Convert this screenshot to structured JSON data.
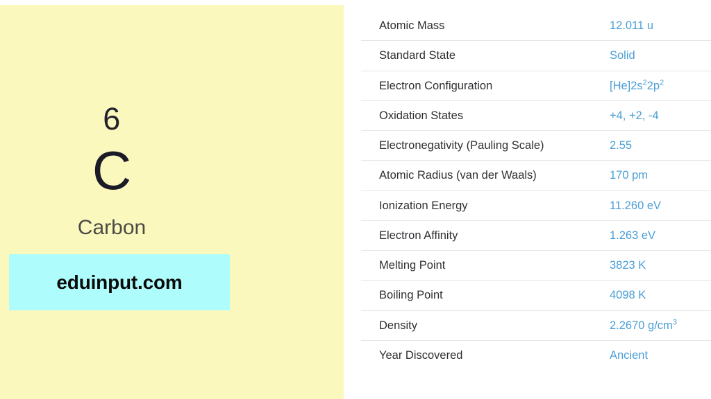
{
  "element": {
    "atomic_number": "6",
    "symbol": "C",
    "name": "Carbon",
    "tile_background": "#fbf8be",
    "symbol_color": "#1b1b28",
    "name_color": "#4b4b45"
  },
  "brand": {
    "label": "eduinput.com",
    "background": "#aefcfc",
    "text_color": "#0b0b0b"
  },
  "properties": {
    "value_color": "#4a9ed6",
    "label_color": "#2f2f33",
    "divider_color": "#e6e6e6",
    "rows": [
      {
        "label": "Atomic Mass",
        "value": "12.011 u",
        "value_parts": [
          {
            "text": "12.011 u",
            "sup": false
          }
        ]
      },
      {
        "label": "Standard State",
        "value": "Solid",
        "value_parts": [
          {
            "text": "Solid",
            "sup": false
          }
        ]
      },
      {
        "label": "Electron Configuration",
        "value": "[He]2s22p2",
        "value_parts": [
          {
            "text": "[He]2s",
            "sup": false
          },
          {
            "text": "2",
            "sup": true
          },
          {
            "text": "2p",
            "sup": false
          },
          {
            "text": "2",
            "sup": true
          }
        ]
      },
      {
        "label": "Oxidation States",
        "value": "+4, +2, -4",
        "value_parts": [
          {
            "text": "+4, +2, -4",
            "sup": false
          }
        ]
      },
      {
        "label": "Electronegativity (Pauling Scale)",
        "value": "2.55",
        "value_parts": [
          {
            "text": "2.55",
            "sup": false
          }
        ]
      },
      {
        "label": "Atomic Radius (van der Waals)",
        "value": "170 pm",
        "value_parts": [
          {
            "text": "170 pm",
            "sup": false
          }
        ]
      },
      {
        "label": "Ionization Energy",
        "value": "11.260 eV",
        "value_parts": [
          {
            "text": "11.260 eV",
            "sup": false
          }
        ]
      },
      {
        "label": "Electron Affinity",
        "value": "1.263 eV",
        "value_parts": [
          {
            "text": "1.263 eV",
            "sup": false
          }
        ]
      },
      {
        "label": "Melting Point",
        "value": "3823 K",
        "value_parts": [
          {
            "text": "3823 K",
            "sup": false
          }
        ]
      },
      {
        "label": "Boiling Point",
        "value": "4098 K",
        "value_parts": [
          {
            "text": "4098 K",
            "sup": false
          }
        ]
      },
      {
        "label": "Density",
        "value": "2.2670 g/cm3",
        "value_parts": [
          {
            "text": "2.2670 g/cm",
            "sup": false
          },
          {
            "text": "3",
            "sup": true
          }
        ]
      },
      {
        "label": "Year Discovered",
        "value": "Ancient",
        "value_parts": [
          {
            "text": "Ancient",
            "sup": false
          }
        ]
      }
    ]
  }
}
